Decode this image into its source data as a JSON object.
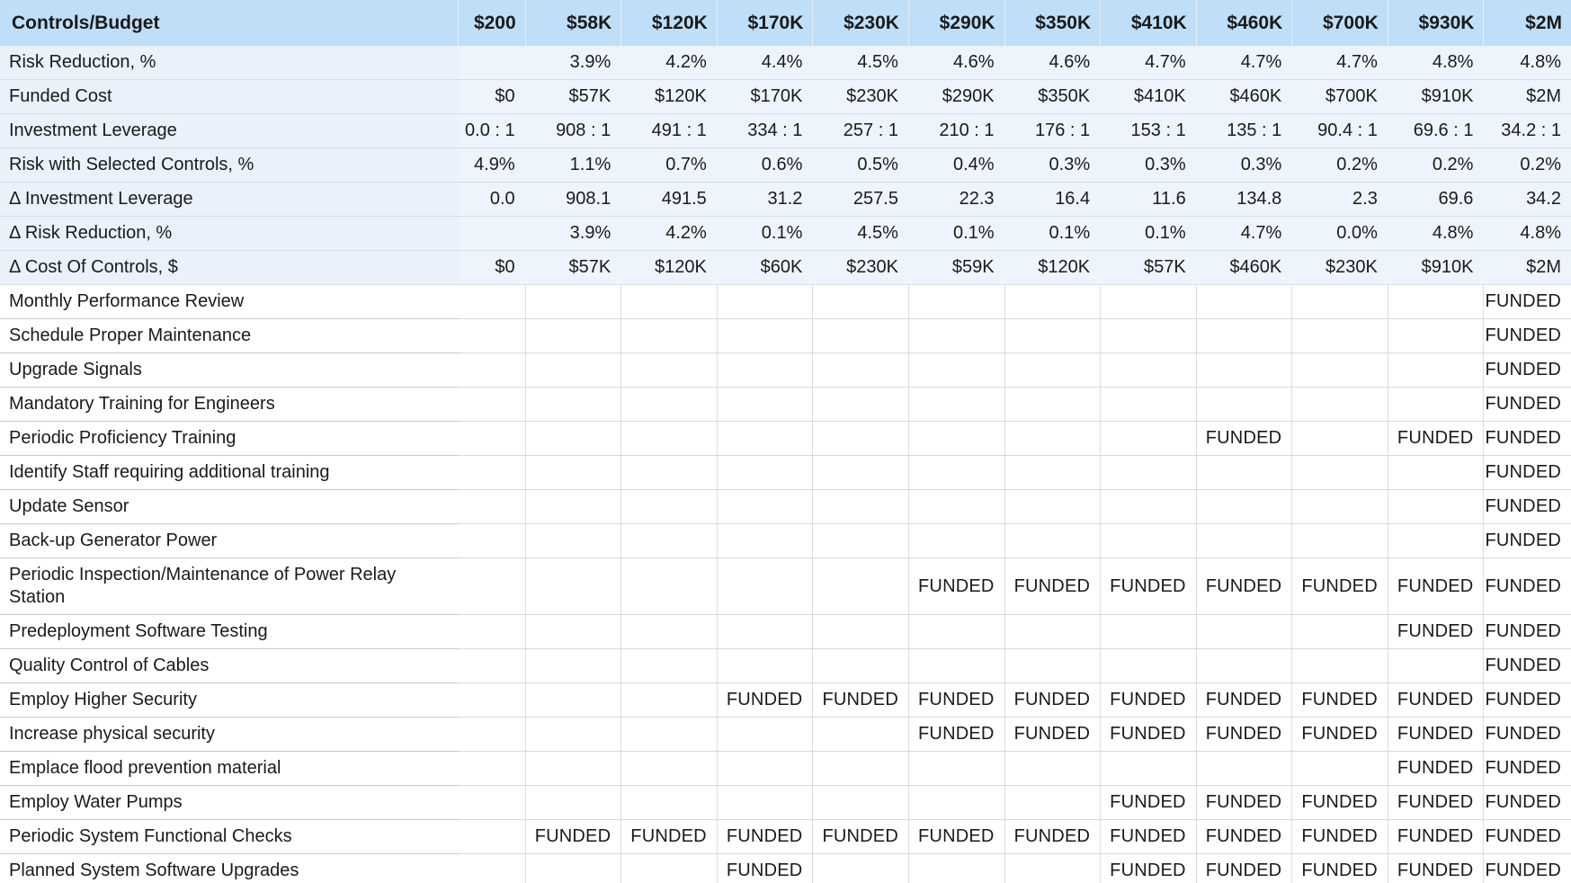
{
  "table": {
    "corner_label": "Controls/Budget",
    "budgets": [
      "$200",
      "$58K",
      "$120K",
      "$170K",
      "$230K",
      "$290K",
      "$350K",
      "$410K",
      "$460K",
      "$700K",
      "$930K",
      "$2M"
    ],
    "metrics": [
      {
        "label": "Risk Reduction, %",
        "values": [
          "",
          "3.9%",
          "4.2%",
          "4.4%",
          "4.5%",
          "4.6%",
          "4.6%",
          "4.7%",
          "4.7%",
          "4.7%",
          "4.8%",
          "4.8%"
        ]
      },
      {
        "label": "Funded Cost",
        "values": [
          "$0",
          "$57K",
          "$120K",
          "$170K",
          "$230K",
          "$290K",
          "$350K",
          "$410K",
          "$460K",
          "$700K",
          "$910K",
          "$2M"
        ]
      },
      {
        "label": "Investment Leverage",
        "values": [
          "0.0 : 1",
          "908 : 1",
          "491 : 1",
          "334 : 1",
          "257 : 1",
          "210 : 1",
          "176 : 1",
          "153 : 1",
          "135 : 1",
          "90.4 : 1",
          "69.6 : 1",
          "34.2 : 1"
        ]
      },
      {
        "label": "Risk with Selected Controls, %",
        "values": [
          "4.9%",
          "1.1%",
          "0.7%",
          "0.6%",
          "0.5%",
          "0.4%",
          "0.3%",
          "0.3%",
          "0.3%",
          "0.2%",
          "0.2%",
          "0.2%"
        ]
      },
      {
        "label": "Δ Investment Leverage",
        "values": [
          "0.0",
          "908.1",
          "491.5",
          "31.2",
          "257.5",
          "22.3",
          "16.4",
          "11.6",
          "134.8",
          "2.3",
          "69.6",
          "34.2"
        ]
      },
      {
        "label": "Δ Risk Reduction, %",
        "values": [
          "",
          "3.9%",
          "4.2%",
          "0.1%",
          "4.5%",
          "0.1%",
          "0.1%",
          "0.1%",
          "4.7%",
          "0.0%",
          "4.8%",
          "4.8%"
        ]
      },
      {
        "label": "Δ Cost Of Controls, $",
        "values": [
          "$0",
          "$57K",
          "$120K",
          "$60K",
          "$230K",
          "$59K",
          "$120K",
          "$57K",
          "$460K",
          "$230K",
          "$910K",
          "$2M"
        ]
      }
    ],
    "controls": [
      {
        "label": "Monthly Performance Review",
        "values": [
          "",
          "",
          "",
          "",
          "",
          "",
          "",
          "",
          "",
          "",
          "",
          "FUNDED"
        ]
      },
      {
        "label": "Schedule Proper Maintenance",
        "values": [
          "",
          "",
          "",
          "",
          "",
          "",
          "",
          "",
          "",
          "",
          "",
          "FUNDED"
        ]
      },
      {
        "label": "Upgrade Signals",
        "values": [
          "",
          "",
          "",
          "",
          "",
          "",
          "",
          "",
          "",
          "",
          "",
          "FUNDED"
        ]
      },
      {
        "label": "Mandatory Training for Engineers",
        "values": [
          "",
          "",
          "",
          "",
          "",
          "",
          "",
          "",
          "",
          "",
          "",
          "FUNDED"
        ]
      },
      {
        "label": "Periodic Proficiency Training",
        "values": [
          "",
          "",
          "",
          "",
          "",
          "",
          "",
          "",
          "FUNDED",
          "",
          "FUNDED",
          "FUNDED"
        ]
      },
      {
        "label": "Identify Staff requiring additional training",
        "values": [
          "",
          "",
          "",
          "",
          "",
          "",
          "",
          "",
          "",
          "",
          "",
          "FUNDED"
        ]
      },
      {
        "label": "Update Sensor",
        "values": [
          "",
          "",
          "",
          "",
          "",
          "",
          "",
          "",
          "",
          "",
          "",
          "FUNDED"
        ]
      },
      {
        "label": "Back-up Generator Power",
        "values": [
          "",
          "",
          "",
          "",
          "",
          "",
          "",
          "",
          "",
          "",
          "",
          "FUNDED"
        ]
      },
      {
        "label": "Periodic Inspection/Maintenance of Power Relay Station",
        "tall": true,
        "values": [
          "",
          "",
          "",
          "",
          "",
          "FUNDED",
          "FUNDED",
          "FUNDED",
          "FUNDED",
          "FUNDED",
          "FUNDED",
          "FUNDED"
        ]
      },
      {
        "label": "Predeployment Software Testing",
        "values": [
          "",
          "",
          "",
          "",
          "",
          "",
          "",
          "",
          "",
          "",
          "FUNDED",
          "FUNDED"
        ]
      },
      {
        "label": "Quality Control of Cables",
        "values": [
          "",
          "",
          "",
          "",
          "",
          "",
          "",
          "",
          "",
          "",
          "",
          "FUNDED"
        ]
      },
      {
        "label": "Employ Higher Security",
        "values": [
          "",
          "",
          "",
          "FUNDED",
          "FUNDED",
          "FUNDED",
          "FUNDED",
          "FUNDED",
          "FUNDED",
          "FUNDED",
          "FUNDED",
          "FUNDED"
        ]
      },
      {
        "label": "Increase physical security",
        "values": [
          "",
          "",
          "",
          "",
          "",
          "FUNDED",
          "FUNDED",
          "FUNDED",
          "FUNDED",
          "FUNDED",
          "FUNDED",
          "FUNDED"
        ]
      },
      {
        "label": "Emplace flood prevention material",
        "values": [
          "",
          "",
          "",
          "",
          "",
          "",
          "",
          "",
          "",
          "",
          "FUNDED",
          "FUNDED"
        ]
      },
      {
        "label": "Employ Water Pumps",
        "values": [
          "",
          "",
          "",
          "",
          "",
          "",
          "",
          "FUNDED",
          "FUNDED",
          "FUNDED",
          "FUNDED",
          "FUNDED"
        ]
      },
      {
        "label": "Periodic System Functional Checks",
        "values": [
          "",
          "FUNDED",
          "FUNDED",
          "FUNDED",
          "FUNDED",
          "FUNDED",
          "FUNDED",
          "FUNDED",
          "FUNDED",
          "FUNDED",
          "FUNDED",
          "FUNDED"
        ]
      },
      {
        "label": "Planned System Software Upgrades",
        "values": [
          "",
          "",
          "",
          "FUNDED",
          "",
          "",
          "",
          "FUNDED",
          "FUNDED",
          "FUNDED",
          "FUNDED",
          "FUNDED"
        ]
      }
    ]
  }
}
